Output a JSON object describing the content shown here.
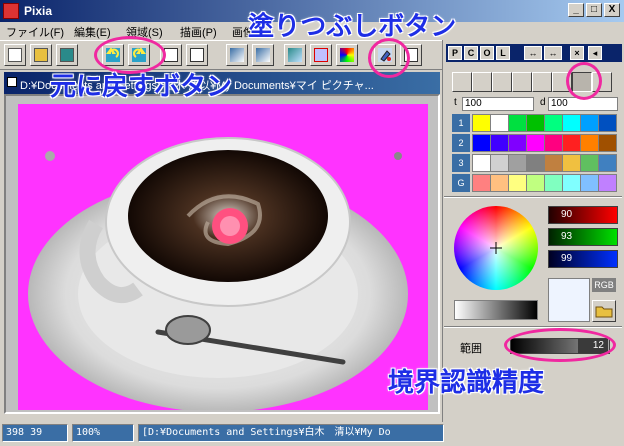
{
  "window": {
    "title": "Pixia",
    "min": "_",
    "max": "□",
    "close": "X"
  },
  "menu": [
    "ファイル(F)",
    "編集(E)",
    "領域(S)",
    "描画(P)",
    "画像"
  ],
  "document": {
    "title": "D:¥Documents and Settings¥白木 清以¥My Documents¥マイ ピクチャ..."
  },
  "panel": {
    "tabs": [
      "P",
      "C",
      "O",
      "L"
    ],
    "thickness_label": "t",
    "thickness_value": "100",
    "density_label": "d",
    "density_value": "100",
    "swatch_rows": [
      "1",
      "2",
      "3",
      "G"
    ],
    "rgb": {
      "r": "90",
      "g": "93",
      "b": "99"
    },
    "rgb_mode_label": "RGB",
    "range_label": "範囲",
    "range_value": "12"
  },
  "status": {
    "coords": "398 39",
    "zoom": "100%",
    "path": "[D:¥Documents and Settings¥白木　清以¥My Do"
  },
  "annotations": {
    "fill_button": "塗りつぶしボタン",
    "undo_button": "元に戻すボタン",
    "boundary_precision": "境界認識精度"
  },
  "colors": {
    "accent_title": "#0a246a",
    "annotation_text": "#1e2ee6",
    "annotation_circle": "#f028a0",
    "canvas_bg": "#ff33ff"
  }
}
